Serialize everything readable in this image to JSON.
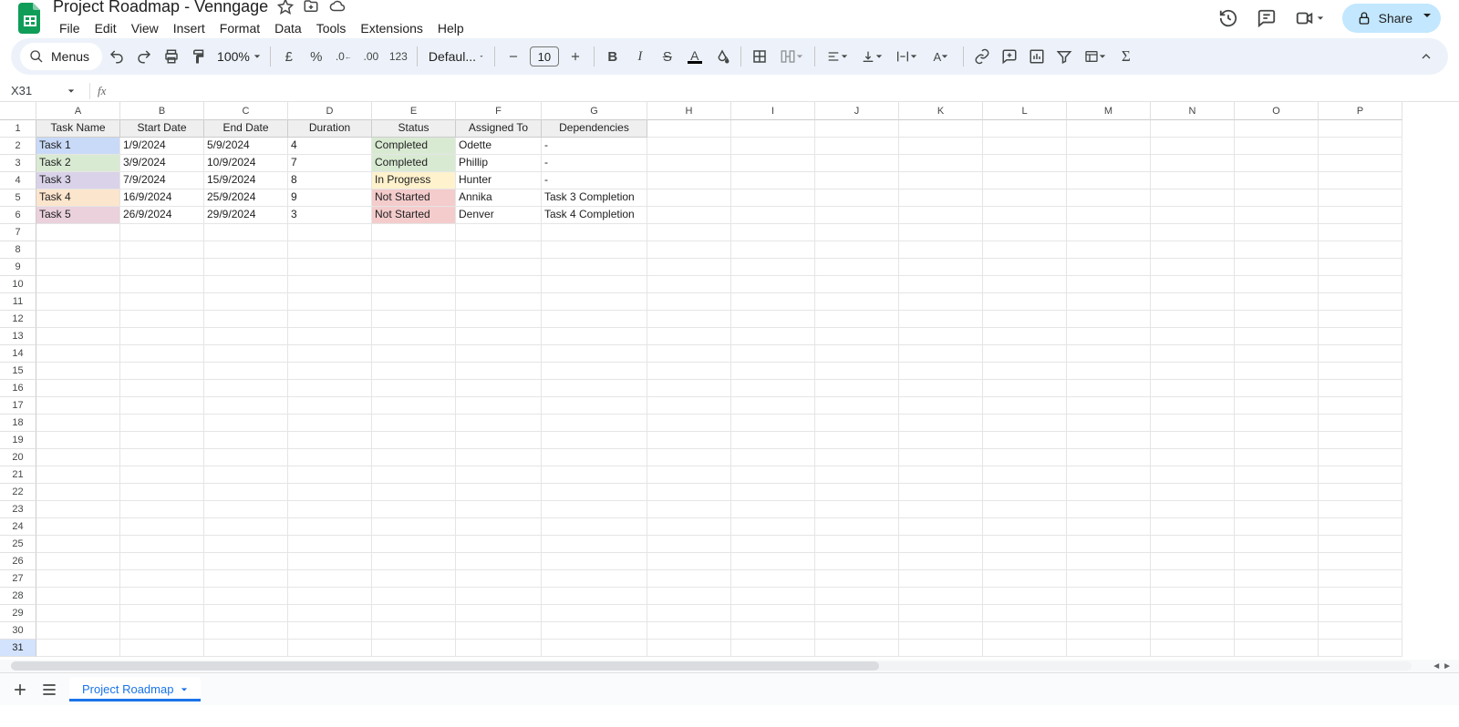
{
  "docTitle": "Project Roadmap - Venngage",
  "menus": [
    "File",
    "Edit",
    "View",
    "Insert",
    "Format",
    "Data",
    "Tools",
    "Extensions",
    "Help"
  ],
  "share": "Share",
  "searchPill": "Menus",
  "zoom": "100%",
  "fontName": "Defaul...",
  "fontSize": "10",
  "nameBox": "X31",
  "columns": [
    "A",
    "B",
    "C",
    "D",
    "E",
    "F",
    "G",
    "H",
    "I",
    "J",
    "K",
    "L",
    "M",
    "N",
    "O",
    "P"
  ],
  "sheetTab": "Project Roadmap",
  "headers": [
    "Task Name",
    "Start Date",
    "End Date",
    "Duration",
    "Status",
    "Assigned To",
    "Dependencies"
  ],
  "rows": [
    {
      "task": "Task 1",
      "start": "1/9/2024",
      "end": "5/9/2024",
      "dur": "4",
      "status": "Completed",
      "assignee": "Odette",
      "dep": "-",
      "taskBg": "#c9daf8",
      "statusBg": "#d9ead3"
    },
    {
      "task": "Task 2",
      "start": "3/9/2024",
      "end": "10/9/2024",
      "dur": "7",
      "status": "Completed",
      "assignee": "Phillip",
      "dep": "-",
      "taskBg": "#d9ead3",
      "statusBg": "#d9ead3"
    },
    {
      "task": "Task 3",
      "start": "7/9/2024",
      "end": "15/9/2024",
      "dur": "8",
      "status": "In Progress",
      "assignee": "Hunter",
      "dep": "-",
      "taskBg": "#d9d2e9",
      "statusBg": "#fff2cc"
    },
    {
      "task": "Task 4",
      "start": "16/9/2024",
      "end": "25/9/2024",
      "dur": "9",
      "status": "Not Started",
      "assignee": "Annika",
      "dep": "Task 3 Completion",
      "taskBg": "#fce5cd",
      "statusBg": "#f4cccc"
    },
    {
      "task": "Task 5",
      "start": "26/9/2024",
      "end": "29/9/2024",
      "dur": "3",
      "status": "Not Started",
      "assignee": "Denver",
      "dep": "Task 4 Completion",
      "taskBg": "#ead1dc",
      "statusBg": "#f4cccc"
    }
  ],
  "selectedRow": 31,
  "totalRows": 31
}
